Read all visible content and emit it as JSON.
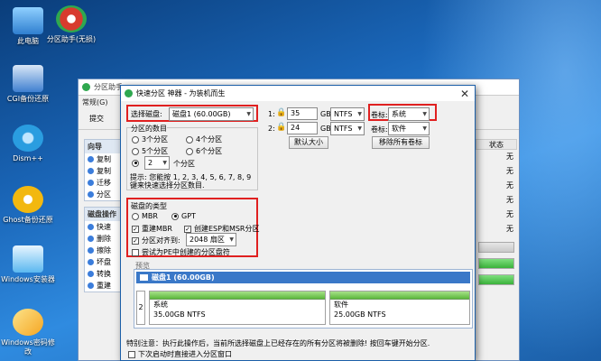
{
  "desktop": {
    "icons": [
      {
        "label": "此电脑",
        "color": "#4fa3e8"
      },
      {
        "label": "分区助手(无损)",
        "color": "#d83b2e"
      },
      {
        "label": "CGI备份还原",
        "color": "#3f7fd0"
      },
      {
        "label": "Dism++",
        "color": "#2a9de0"
      },
      {
        "label": "Ghost备份还原",
        "color": "#f2b80f"
      },
      {
        "label": "Windows安装器",
        "color": "#5bb8f0"
      },
      {
        "label": "Windows密码修改",
        "color": "#f5c030"
      }
    ]
  },
  "bg_app": {
    "title": "分区助手",
    "menu": [
      "常规(G)"
    ],
    "toolbar_label": "提交",
    "sidebar": {
      "wizard_header": "向导",
      "wizard_items": [
        "复制",
        "复制",
        "迁移",
        "分区"
      ],
      "disk_header": "磁盘操作",
      "disk_items": [
        "快速",
        "删除",
        "擦除",
        "坏盘",
        "转换",
        "重建"
      ]
    },
    "right_col": {
      "header": "状态",
      "values": [
        "无",
        "无",
        "无",
        "无",
        "无",
        "无"
      ]
    }
  },
  "dialog": {
    "title": "快速分区 神器 - 为装机而生",
    "select_disk_label": "选择磁盘:",
    "select_disk_value": "磁盘1 (60.00GB)",
    "partition_count_label": "分区的数目",
    "partition_options": [
      {
        "label": "3个分区",
        "selected": false
      },
      {
        "label": "4个分区",
        "selected": false
      },
      {
        "label": "5个分区",
        "selected": false
      },
      {
        "label": "6个分区",
        "selected": false
      },
      {
        "label": "",
        "selected": true
      },
      {
        "label": "",
        "selected": false
      }
    ],
    "custom_count_value": "2",
    "custom_count_unit": "个分区",
    "tip": "提示: 您能按 1, 2, 3, 4, 5, 6, 7, 8, 9 键来快速选择分区数目.",
    "partitions": [
      {
        "index": "1:",
        "size": "35",
        "unit": "GB",
        "fs": "NTFS",
        "label_caption": "卷标:",
        "label": "系统"
      },
      {
        "index": "2:",
        "size": "24",
        "unit": "GB",
        "fs": "NTFS",
        "label_caption": "卷标:",
        "label": "软件"
      }
    ],
    "default_size_btn": "默认大小",
    "remove_labels_btn": "移除所有卷标",
    "disk_type_label": "磁盘的类型",
    "mbr_label": "MBR",
    "gpt_label": "GPT",
    "rebuild_mbr_label": "重建MBR",
    "create_esp_label": "创建ESP和MSR分区",
    "align_label": "分区对齐到:",
    "align_value": "2048 扇区",
    "pe_label": "尝试为PE中创建的分区盘符",
    "preview_label": "预览",
    "preview": {
      "disk_title": "磁盘1 (60.00GB)",
      "disk_num": "2",
      "parts": [
        {
          "name": "系统",
          "info": "35.00GB NTFS"
        },
        {
          "name": "软件",
          "info": "25.00GB NTFS"
        }
      ]
    },
    "warning": "特别注意：执行此操作后，当前所选择磁盘上已经存在的所有分区将被删除! 按回车键开始分区.",
    "next_boot_label": "下次启动时直接进入分区窗口"
  }
}
